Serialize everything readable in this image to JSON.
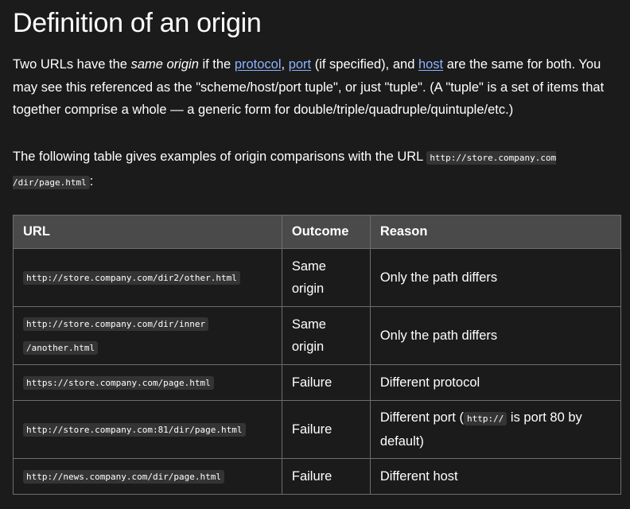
{
  "heading": "Definition of an origin",
  "intro": {
    "t1": "Two URLs have the ",
    "same_origin": "same origin",
    "t2": " if the ",
    "link_protocol": "protocol",
    "t3": ", ",
    "link_port": "port",
    "t4": " (if specified), and ",
    "link_host": "host",
    "t5": " are the same for both. You may see this referenced as the \"scheme/host/port tuple\", or just \"tuple\". (A \"tuple\" is a set of items that together comprise a whole — a generic form for double/triple/quadruple/quintuple/etc.)"
  },
  "table_intro": {
    "text": "The following table gives examples of origin comparisons with the URL ",
    "code_part1": "http://store.company.com",
    "code_part2": "/dir/page.html",
    "suffix": ":"
  },
  "table": {
    "headers": [
      "URL",
      "Outcome",
      "Reason"
    ],
    "rows": [
      {
        "url_part1": "http://store.company.com/dir2/other.html",
        "url_part2": "",
        "outcome_line1": "Same",
        "outcome_line2": "origin",
        "reason": "Only the path differs",
        "reason_code": "",
        "reason_suffix": ""
      },
      {
        "url_part1": "http://store.company.com/dir/inner",
        "url_part2": "/another.html",
        "outcome_line1": "Same",
        "outcome_line2": "origin",
        "reason": "Only the path differs",
        "reason_code": "",
        "reason_suffix": ""
      },
      {
        "url_part1": "https://store.company.com/page.html",
        "url_part2": "",
        "outcome_line1": "Failure",
        "outcome_line2": "",
        "reason": "Different protocol",
        "reason_code": "",
        "reason_suffix": ""
      },
      {
        "url_part1": "http://store.company.com:81/dir/page.html",
        "url_part2": "",
        "outcome_line1": "Failure",
        "outcome_line2": "",
        "reason": "Different port (",
        "reason_code": "http://",
        "reason_suffix": " is port 80 by default)"
      },
      {
        "url_part1": "http://news.company.com/dir/page.html",
        "url_part2": "",
        "outcome_line1": "Failure",
        "outcome_line2": "",
        "reason": "Different host",
        "reason_code": "",
        "reason_suffix": ""
      }
    ]
  },
  "colors": {
    "background": "#1b1b1b",
    "link": "#8cb4ff",
    "header_bg": "#4a4a4a",
    "code_bg": "#343434",
    "border": "#6e6e6e"
  }
}
